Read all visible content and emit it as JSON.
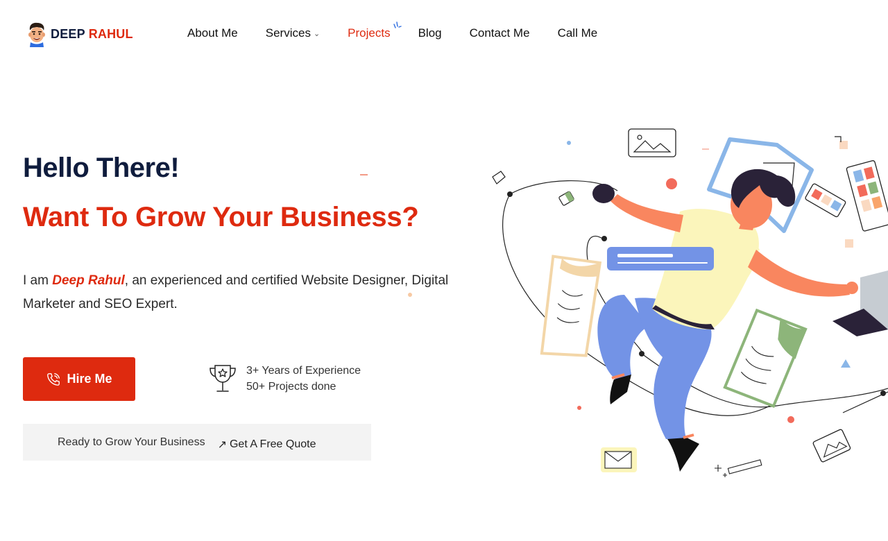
{
  "brand": {
    "name_part1": "DEEP",
    "name_part2": "RAHUL"
  },
  "nav": {
    "items": [
      {
        "label": "About Me"
      },
      {
        "label": "Services"
      },
      {
        "label": "Projects"
      },
      {
        "label": "Blog"
      },
      {
        "label": "Contact Me"
      },
      {
        "label": "Call Me"
      }
    ],
    "active": "Projects"
  },
  "hero": {
    "greeting": "Hello There!",
    "headline": "Want To Grow Your Business?",
    "intro_prefix": "I am ",
    "intro_name": "Deep Rahul",
    "intro_suffix": ", an experienced and certified Website Designer, Digital Marketer and SEO Expert.",
    "hire_button": "Hire Me",
    "experience_line1": "3+ Years of Experience",
    "experience_line2": "50+ Projects done",
    "quote_prompt": "Ready to Grow Your Business",
    "quote_link": "Get A Free Quote"
  },
  "icons": {
    "avatar": "avatar-icon",
    "services_dropdown": "chevron-down-icon",
    "phone": "phone-icon",
    "trophy": "trophy-icon",
    "arrow": "arrow-up-right-icon"
  },
  "colors": {
    "accent": "#de2a0f",
    "navy": "#0f1c3d",
    "quote_bg": "#f3f3f3"
  }
}
